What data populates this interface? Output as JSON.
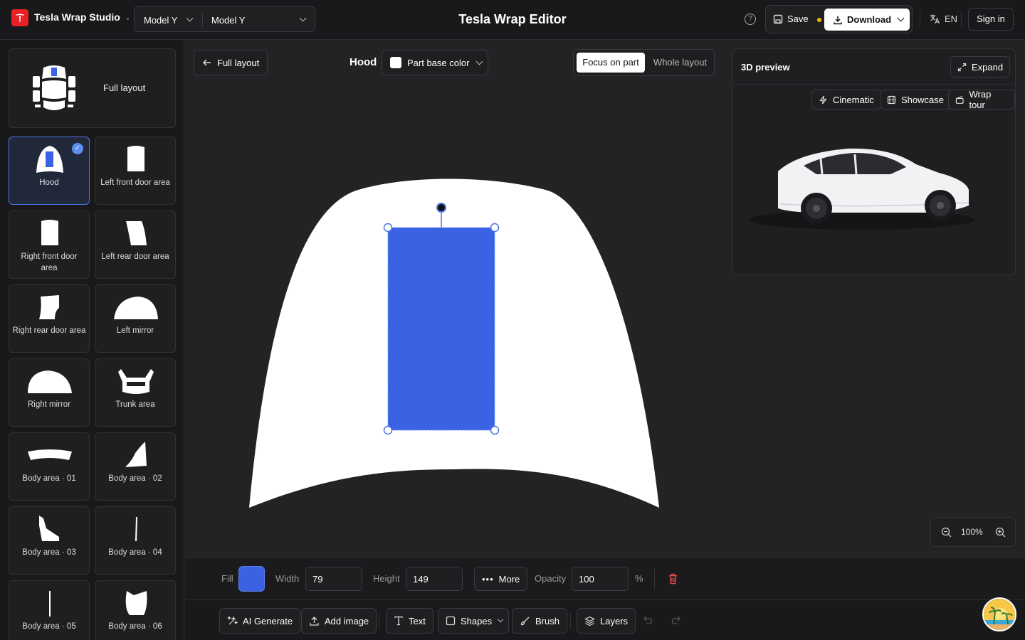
{
  "app": {
    "name": "Tesla Wrap Studio",
    "title": "Tesla Wrap Editor"
  },
  "header": {
    "model_primary": "Model Y",
    "model_secondary": "Model Y",
    "save_label": "Save",
    "download_label": "Download",
    "language_label": "EN",
    "signin_label": "Sign in",
    "unsaved_color": "#f5b400"
  },
  "sidebar": {
    "full_layout_label": "Full layout",
    "parts": [
      {
        "label": "Hood",
        "selected": true
      },
      {
        "label": "Left front door area"
      },
      {
        "label": "Right front door area"
      },
      {
        "label": "Left rear door area"
      },
      {
        "label": "Right rear door area"
      },
      {
        "label": "Left mirror"
      },
      {
        "label": "Right mirror"
      },
      {
        "label": "Trunk area"
      },
      {
        "label": "Body area · 01"
      },
      {
        "label": "Body area · 02"
      },
      {
        "label": "Body area · 03"
      },
      {
        "label": "Body area · 04"
      },
      {
        "label": "Body area · 05"
      },
      {
        "label": "Body area · 06"
      }
    ]
  },
  "canvas": {
    "back_label": "Full layout",
    "part_name": "Hood",
    "base_color_label": "Part base color",
    "focus_label": "Focus on part",
    "whole_label": "Whole layout",
    "shape_color": "#3a62e3"
  },
  "preview": {
    "title": "3D preview",
    "expand_label": "Expand",
    "cinematic_label": "Cinematic",
    "showcase_label": "Showcase",
    "wrap_tour_label": "Wrap tour"
  },
  "zoom": {
    "value": "100%"
  },
  "props": {
    "fill_label": "Fill",
    "width_label": "Width",
    "width_value": "79",
    "height_label": "Height",
    "height_value": "149",
    "more_label": "More",
    "opacity_label": "Opacity",
    "opacity_value": "100",
    "opacity_unit": "%"
  },
  "toolbar": {
    "ai_label": "AI Generate",
    "add_image_label": "Add image",
    "text_label": "Text",
    "shapes_label": "Shapes",
    "brush_label": "Brush",
    "layers_label": "Layers"
  }
}
